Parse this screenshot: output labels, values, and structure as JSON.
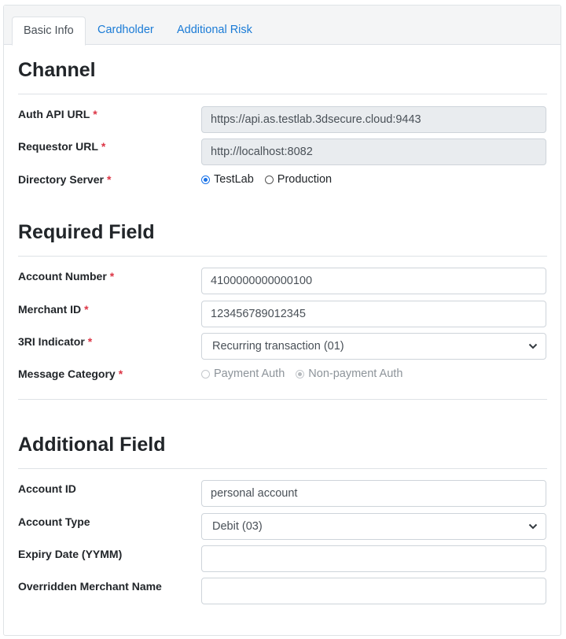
{
  "tabs": [
    {
      "label": "Basic Info",
      "active": true
    },
    {
      "label": "Cardholder",
      "active": false
    },
    {
      "label": "Additional Risk",
      "active": false
    }
  ],
  "channel": {
    "title": "Channel",
    "auth_api_url": {
      "label": "Auth API URL",
      "required": "*",
      "value": "https://api.as.testlab.3dsecure.cloud:9443"
    },
    "requestor_url": {
      "label": "Requestor URL",
      "required": "*",
      "value": "http://localhost:8082"
    },
    "directory_server": {
      "label": "Directory Server",
      "required": "*",
      "options": [
        {
          "label": "TestLab",
          "checked": true
        },
        {
          "label": "Production",
          "checked": false
        }
      ]
    }
  },
  "required_field": {
    "title": "Required Field",
    "account_number": {
      "label": "Account Number",
      "required": "*",
      "value": "4100000000000100"
    },
    "merchant_id": {
      "label": "Merchant ID",
      "required": "*",
      "value": "123456789012345"
    },
    "three_ri_indicator": {
      "label": "3RI Indicator",
      "required": "*",
      "value": "Recurring transaction (01)"
    },
    "message_category": {
      "label": "Message Category",
      "required": "*",
      "options": [
        {
          "label": "Payment Auth",
          "checked": false
        },
        {
          "label": "Non-payment Auth",
          "checked": true
        }
      ]
    }
  },
  "additional_field": {
    "title": "Additional Field",
    "account_id": {
      "label": "Account ID",
      "value": "personal account"
    },
    "account_type": {
      "label": "Account Type",
      "value": "Debit (03)"
    },
    "expiry_date": {
      "label": "Expiry Date (YYMM)",
      "value": ""
    },
    "overridden_merchant_name": {
      "label": "Overridden Merchant Name",
      "value": ""
    }
  },
  "colors": {
    "link": "#1a7bd6",
    "required": "#dc3545",
    "radio_checked": "#1a73e8"
  },
  "icons": {
    "select_arrow": "chevron-down-icon"
  }
}
